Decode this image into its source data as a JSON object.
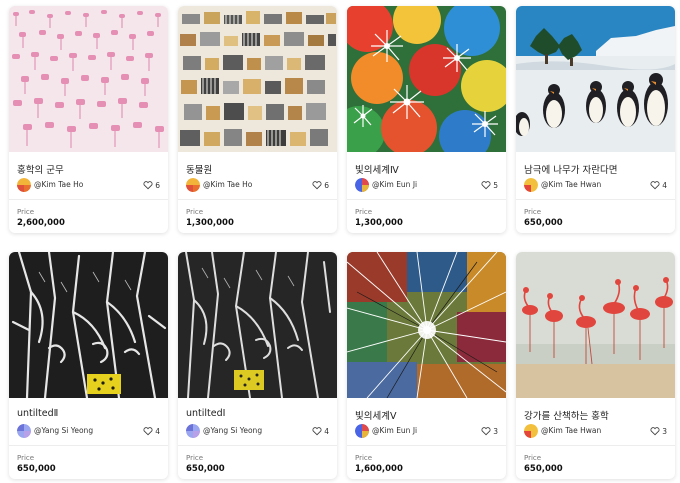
{
  "labels": {
    "price": "Price"
  },
  "artworks": [
    {
      "title": "홍학의 군무",
      "artist": "@Kim Tae Ho",
      "likes": "6",
      "price": "2,600,000",
      "avatar": "avatar-kim-tae-ho-icon",
      "image": "pink-flamingo-crowd-artwork"
    },
    {
      "title": "동물원",
      "artist": "@Kim Tae Ho",
      "likes": "6",
      "price": "1,300,000",
      "avatar": "avatar-kim-tae-ho-icon",
      "image": "zoo-animals-artwork"
    },
    {
      "title": "빛의세계Ⅳ",
      "artist": "@Kim Eun Ji",
      "likes": "5",
      "price": "1,300,000",
      "avatar": "avatar-kim-eun-ji-icon",
      "image": "colorful-light-burst-artwork"
    },
    {
      "title": "남극에 나무가 자란다면",
      "artist": "@Kim Tae Hwan",
      "likes": "4",
      "price": "650,000",
      "avatar": "avatar-kim-tae-hwan-icon",
      "image": "penguins-antarctica-artwork"
    },
    {
      "title": "untiltedⅡ",
      "artist": "@Yang Si Yeong",
      "likes": "4",
      "price": "650,000",
      "avatar": "avatar-yang-si-yeong-icon",
      "image": "black-white-figures-artwork"
    },
    {
      "title": "untiltedⅠ",
      "artist": "@Yang Si Yeong",
      "likes": "4",
      "price": "650,000",
      "avatar": "avatar-yang-si-yeong-icon",
      "image": "black-white-figures-artwork"
    },
    {
      "title": "빛의세계Ⅴ",
      "artist": "@Kim Eun Ji",
      "likes": "3",
      "price": "1,600,000",
      "avatar": "avatar-kim-eun-ji-icon",
      "image": "light-burst-lines-artwork"
    },
    {
      "title": "강가를 산책하는 홍학",
      "artist": "@Kim Tae Hwan",
      "likes": "3",
      "price": "650,000",
      "avatar": "avatar-kim-tae-hwan-icon",
      "image": "flamingos-riverside-artwork"
    }
  ],
  "colors": {
    "heart": "#444444",
    "price_text": "#111111",
    "avatar_kim_tae_ho": [
      "#f2b53a",
      "#e0503a"
    ],
    "avatar_kim_eun_ji": [
      "#4a64e6",
      "#e04a4a"
    ],
    "avatar_kim_tae_hwan": [
      "#f3c03d",
      "#e4463a"
    ],
    "avatar_yang_si_yeong": [
      "#9aa6f0",
      "#6b72d8"
    ]
  }
}
